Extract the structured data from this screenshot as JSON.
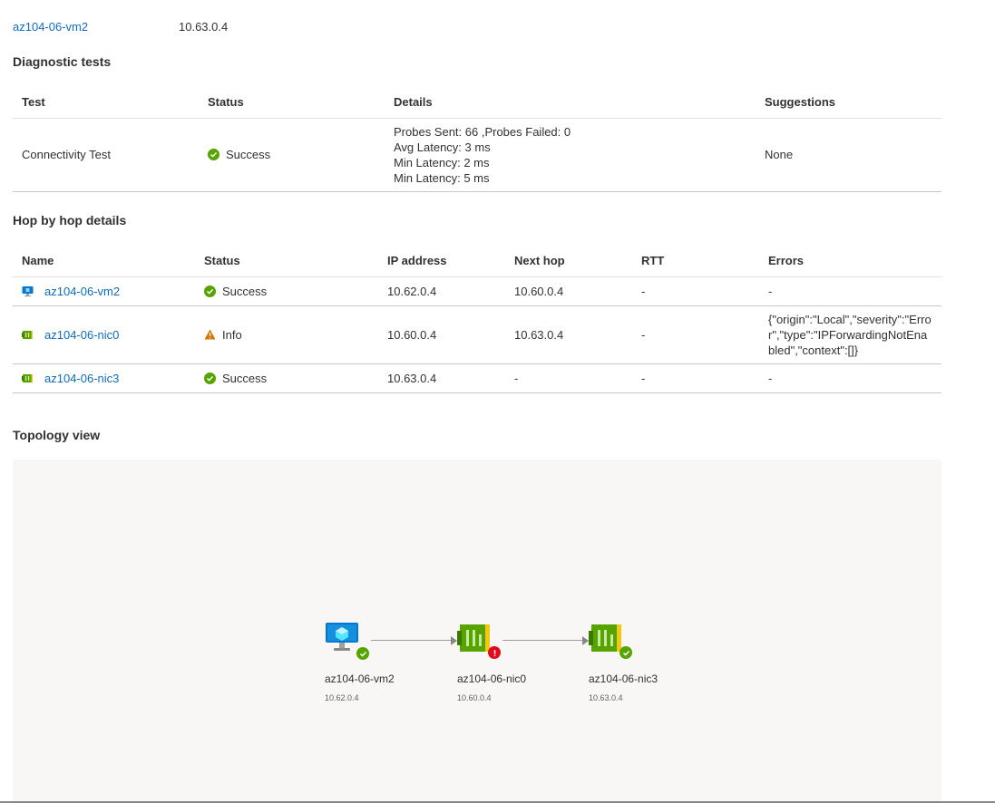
{
  "source": {
    "vm_name": "az104-06-vm2",
    "ip": "10.63.0.4"
  },
  "diagnostic": {
    "title": "Diagnostic tests",
    "headers": [
      "Test",
      "Status",
      "Details",
      "Suggestions"
    ],
    "row": {
      "test": "Connectivity Test",
      "status": "Success",
      "details": [
        "Probes Sent: 66 ,Probes Failed: 0",
        "Avg Latency: 3 ms",
        "Min Latency: 2 ms",
        "Min Latency: 5 ms"
      ],
      "suggestions": "None"
    }
  },
  "hops": {
    "title": "Hop by hop details",
    "headers": [
      "Name",
      "Status",
      "IP address",
      "Next hop",
      "RTT",
      "Errors"
    ],
    "rows": [
      {
        "name": "az104-06-vm2",
        "icon": "vm-icon",
        "status": "Success",
        "ip": "10.62.0.4",
        "next_hop": "10.60.0.4",
        "rtt": "-",
        "errors": "-"
      },
      {
        "name": "az104-06-nic0",
        "icon": "nic-icon",
        "status": "Info",
        "ip": "10.60.0.4",
        "next_hop": "10.63.0.4",
        "rtt": "-",
        "errors": "{\"origin\":\"Local\",\"severity\":\"Error\",\"type\":\"IPForwardingNotEnabled\",\"context\":[]}"
      },
      {
        "name": "az104-06-nic3",
        "icon": "nic-icon",
        "status": "Success",
        "ip": "10.63.0.4",
        "next_hop": "-",
        "rtt": "-",
        "errors": "-"
      }
    ]
  },
  "topology": {
    "title": "Topology view",
    "nodes": [
      {
        "name": "az104-06-vm2",
        "ip": "10.62.0.4",
        "icon": "vm-icon",
        "state": "success"
      },
      {
        "name": "az104-06-nic0",
        "ip": "10.60.0.4",
        "icon": "nic-icon",
        "state": "error"
      },
      {
        "name": "az104-06-nic3",
        "ip": "10.63.0.4",
        "icon": "nic-icon",
        "state": "success"
      }
    ]
  },
  "colors": {
    "link": "#0f6cbd",
    "success": "#57a300",
    "warning": "#d47500",
    "error": "#e00b1c",
    "canvas": "#f8f7f6"
  }
}
